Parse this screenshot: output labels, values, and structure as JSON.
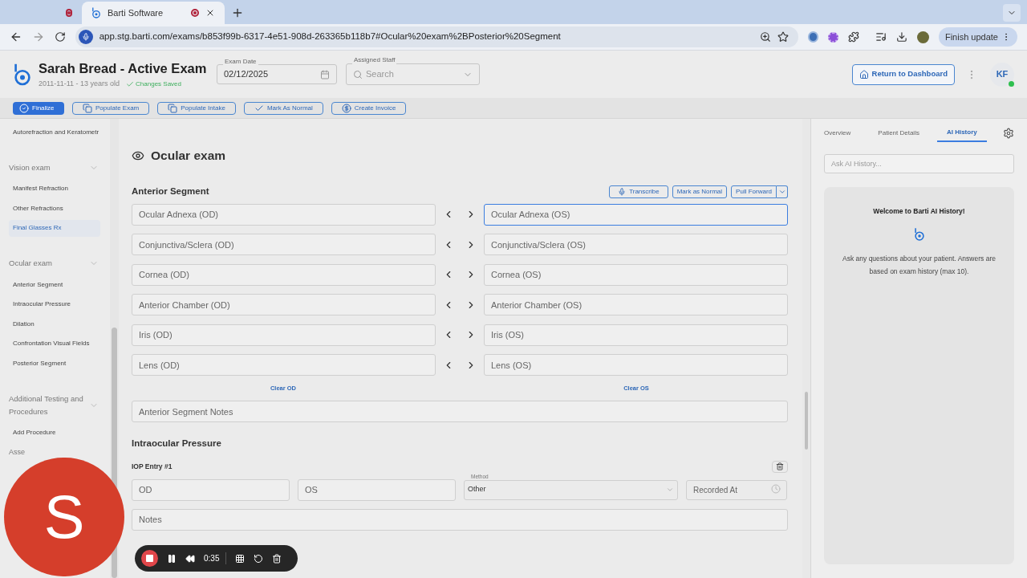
{
  "browser": {
    "tabs": [
      {
        "selected": false,
        "recording": true
      },
      {
        "title": "Barti Software",
        "selected": true,
        "recording": true
      }
    ],
    "url": "app.stg.barti.com/exams/b853f99b-6317-4e51-908d-263365b118b7#Ocular%20exam%2BPosterior%20Segment",
    "update_button": "Finish update"
  },
  "header": {
    "title": "Sarah Bread - Active Exam",
    "subtitle": "2011-11-11 - 13 years old",
    "save_status": "Changes Saved",
    "exam_date": {
      "label": "Exam Date",
      "value": "02/12/2025"
    },
    "assigned_staff": {
      "label": "Assigned Staff",
      "placeholder": "Search"
    },
    "return_button": "Return to Dashboard",
    "avatar": "KF",
    "online": true
  },
  "actions": [
    {
      "label": "Finalize",
      "kind": "finalize",
      "primary": true
    },
    {
      "label": "Populate Exam",
      "kind": "copy",
      "primary": false
    },
    {
      "label": "Populate Intake",
      "kind": "copy",
      "primary": false
    },
    {
      "label": "Mark As Normal",
      "kind": "check",
      "primary": false
    },
    {
      "label": "Create Invoice",
      "kind": "invoice",
      "primary": false
    }
  ],
  "sidebar": [
    {
      "items": [
        {
          "label": "Autorefraction and Keratometr",
          "selected": false
        }
      ]
    },
    {
      "title": "Vision exam",
      "expanded": true,
      "items": [
        {
          "label": "Manifest Refraction",
          "selected": false
        },
        {
          "label": "Other Refractions",
          "selected": false
        },
        {
          "label": "Final Glasses Rx",
          "selected": true
        }
      ]
    },
    {
      "title": "Ocular exam",
      "expanded": true,
      "items": [
        {
          "label": "Anterior Segment",
          "selected": false
        },
        {
          "label": "Intraocular Pressure",
          "selected": false
        },
        {
          "label": "Dilation",
          "selected": false
        },
        {
          "label": "Confrontation Visual Fields",
          "selected": false
        },
        {
          "label": "Posterior Segment",
          "selected": false
        }
      ]
    },
    {
      "title": "Additional Testing and Procedures",
      "expanded": true,
      "items": [
        {
          "label": "Add Procedure",
          "selected": false
        }
      ]
    },
    {
      "title": "Asse"
    }
  ],
  "main": {
    "title": "Ocular exam",
    "anterior": {
      "title": "Anterior Segment",
      "buttons": [
        {
          "label": "Transcribe",
          "kind": "mic"
        },
        {
          "label": "Mark as Normal",
          "kind": "plain"
        },
        {
          "label": "Pull Forward",
          "kind": "split"
        }
      ],
      "rows": [
        {
          "od": {
            "placeholder": "Ocular Adnexa (OD)"
          },
          "os": {
            "placeholder": "Ocular Adnexa (OS)",
            "focused": true
          }
        },
        {
          "od": {
            "placeholder": "Conjunctiva/Sclera (OD)"
          },
          "os": {
            "placeholder": "Conjunctiva/Sclera (OS)",
            "focused": false
          }
        },
        {
          "od": {
            "placeholder": "Cornea (OD)"
          },
          "os": {
            "placeholder": "Cornea (OS)",
            "focused": false
          }
        },
        {
          "od": {
            "placeholder": "Anterior Chamber (OD)"
          },
          "os": {
            "placeholder": "Anterior Chamber (OS)",
            "focused": false
          }
        },
        {
          "od": {
            "placeholder": "Iris (OD)"
          },
          "os": {
            "placeholder": "Iris (OS)",
            "focused": false
          }
        },
        {
          "od": {
            "placeholder": "Lens (OD)"
          },
          "os": {
            "placeholder": "Lens (OS)",
            "focused": false
          }
        }
      ],
      "clear_od": "Clear OD",
      "clear_os": "Clear OS",
      "notes": {
        "placeholder": "Anterior Segment Notes"
      }
    },
    "iop": {
      "title": "Intraocular Pressure",
      "entry": "IOP Entry #1",
      "od": {
        "placeholder": "OD"
      },
      "os": {
        "placeholder": "OS"
      },
      "method_label": "Method",
      "method": "Other",
      "recorded_at": {
        "placeholder": "Recorded At"
      },
      "notes": {
        "placeholder": "Notes"
      }
    }
  },
  "panel": {
    "tabs": [
      {
        "label": "Overview",
        "selected": false
      },
      {
        "label": "Patient Details",
        "selected": false
      },
      {
        "label": "AI History",
        "selected": true
      }
    ],
    "search": {
      "placeholder": "Ask AI History..."
    },
    "welcome": "Welcome to Barti AI History!",
    "text": "Ask any questions about your patient. Answers are based on exam history (max 10)."
  },
  "recorder": {
    "avatar": "S",
    "time": "0:35"
  }
}
